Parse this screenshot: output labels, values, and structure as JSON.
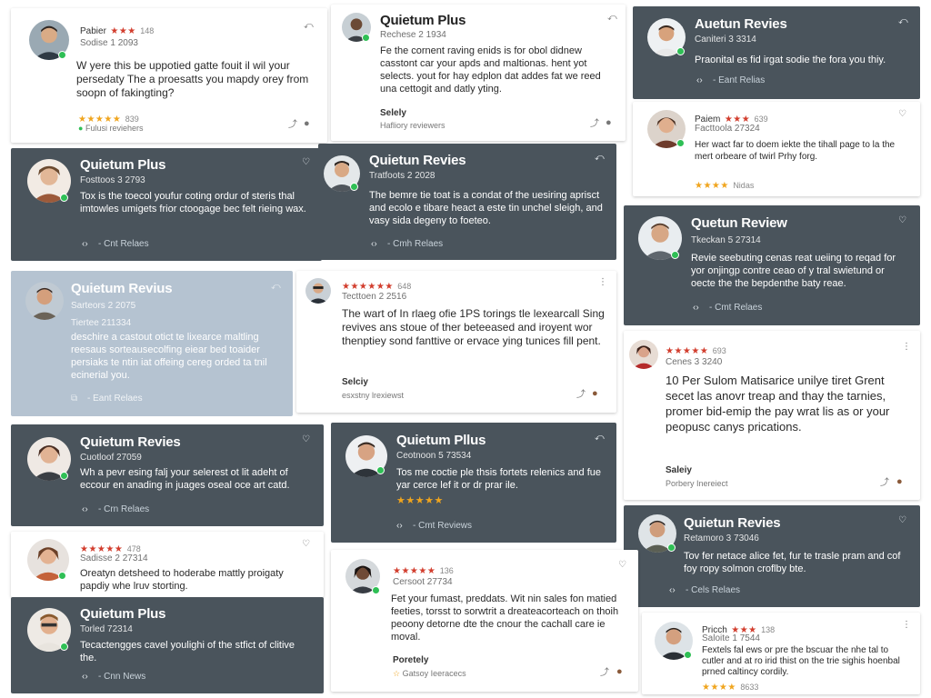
{
  "colors": {
    "dark_card": "#4a545c",
    "blue_card": "#b5c3d1",
    "star": "#f0a51e",
    "star_red": "#d23d2d",
    "badge": "#2fbf55"
  },
  "icons": {
    "save": "bookmark-icon",
    "fav": "heart-icon",
    "more": "more-vertical-icon",
    "expand": "expand-icon",
    "share": "share-icon",
    "chat": "chat-icon"
  },
  "c1": {
    "name": "Pabier",
    "stars": "★★★",
    "num": "148",
    "sub": "Sodise 1 2093",
    "body": "W yere this be uppotied gatte fouit il wil your persedaty The a proesatts you mapdy orey from soopn of fakingting?",
    "stars2": "★★★★★",
    "num2": "839",
    "foot": "Fulusi reviehers"
  },
  "c2": {
    "title": "Quietum Plus",
    "sub": "Rechese 2 1934",
    "body": "Fe the cornent raving enids is for obol didnew casstont car your apds and maltionas. hent yot selects. yout for hay edplon dat addes fat we reed una cettogit and datly yting.",
    "foot_name": "Selely",
    "foot_sub": "Hafliory reviewers"
  },
  "c3": {
    "title": "Auetun Revies",
    "sub": "Caniteri 3 3314",
    "body": "Praonital es fid irgat sodie the fora you thiy.",
    "action": "Eant Relias"
  },
  "c4": {
    "title": "Quietum Plus",
    "sub": "Fosttoos 3 2793",
    "body": "Tox is the toecol youfur coting ordur of steris thal imtowles umigets frior ctoogage bec felt rieing wax.",
    "action": "Cnt Relaes"
  },
  "c5": {
    "title": "Quietun Revies",
    "sub": "Tratfoots 2 2028",
    "body": "The bemre tie toat is a condat of the uesiring aprisct and ecolo e tibare heact a este tin unchel sleigh, and vasy sida degeny to foeteo.",
    "action": "Cmh Relaes"
  },
  "c6": {
    "name": "Paiem",
    "stars": "★★★",
    "num": "639",
    "sub": "Facttoola 27324",
    "body": "Her wact far to doem iekte the tihall page to la the mert orbeare of twirl Prhy forg.",
    "stars2": "★★★★",
    "num2": "Nidas"
  },
  "c7": {
    "title": "Quietum Revius",
    "sub": "Sarteors 2 2075",
    "sub2": "Tiertee 211334",
    "body": "deschire a castout otict te lixearce maltling reesaus sorteausecolfing eiear bed toaider persiaks te ntin iat offeing cereg orded ta tnil ecinerial you.",
    "action": "Eant Relaes"
  },
  "c8": {
    "stars": "★★★★★★",
    "num": "648",
    "sub": "Tecttoen 2 2516",
    "body": "The wart of In rlaeg ofie 1PS torings tle lexearcall Sing revives ans stoue of ther beteeased and iroyent wor thenptiey sond fanttive or ervace ying tunices fill pent.",
    "foot_name": "Selciy",
    "foot_sub": "esxstny lrexiewst"
  },
  "c9": {
    "title": "Quetun Review",
    "sub": "Tkeckan 5 27314",
    "body": "Revie seebuting cenas reat ueiing to reqad for yor onjingp contre ceao of y tral swietund or oecte the the bepdenthe baty reae.",
    "action": "Cmt Relaes"
  },
  "c10": {
    "stars": "★★★★★",
    "num": "693",
    "sub": "Cenes 3 3240",
    "body": "10 Per Sulom Matisarice unilye tiret Grent secet las anovr treap and thay the tarnies, promer bid-emip the pay wrat lis as or your peopusc canys prications.",
    "foot_name": "Saleiy",
    "foot_sub": "Porbery Inereiect"
  },
  "c11": {
    "title": "Quietum Revies",
    "sub": "Cuotloof 27059",
    "body": "Wh a pevr esing falj your selerest ot lit adeht of eccour en anading in juages oseal oce art catd.",
    "action": "Crn Relaes"
  },
  "c12": {
    "title": "Quietum Pllus",
    "sub": "Ceotnoon 5 73534",
    "body": "Tos me coctie ple thsis fortets relenics and fue yar cerce lef it or dr prar ile.",
    "stars": "★★★★★",
    "action": "Cmt Reviews"
  },
  "c13": {
    "title": "Quietun Revies",
    "sub": "Retamoro 3 73046",
    "body": "Tov fer netace alice fet, fur te trasle pram and cof foy ropy solmon croflby bte.",
    "action": "Cels Relaes"
  },
  "c14": {
    "stars": "★★★★★",
    "num": "478",
    "sub": "Sadisse 2 27314",
    "body": "Oreatyn detsheed to hoderabe mattly proigaty papdiy whe lruv storting."
  },
  "c15": {
    "stars": "★★★★★",
    "num": "136",
    "sub": "Cersoot 27734",
    "body": "Fet your fumast, preddats. Wit nin sales fon matied feeties, torsst to sorwtrit a dreateacorteach on thoih peoony detorne dte the cnour the cachall care ie moval.",
    "foot_name": "Poretely",
    "foot_sub": "Gatsoy Ieeracecs"
  },
  "c16": {
    "title": "Quietum Plus",
    "sub": "Torled 72314",
    "body": "Tecactengges cavel youlighi of the stfict of clitive the.",
    "action": "Cnn News"
  },
  "c17": {
    "name": "Pricch",
    "stars": "★★★",
    "num": "138",
    "sub": "Saloite 1 7544",
    "body": "Fextels fal ews or pre the bscuar the nhe tal to cutler and at ro irid thist on the trie sighis hoenbal prned caltincy cordily.",
    "stars2": "★★★★",
    "num2": "8633"
  }
}
